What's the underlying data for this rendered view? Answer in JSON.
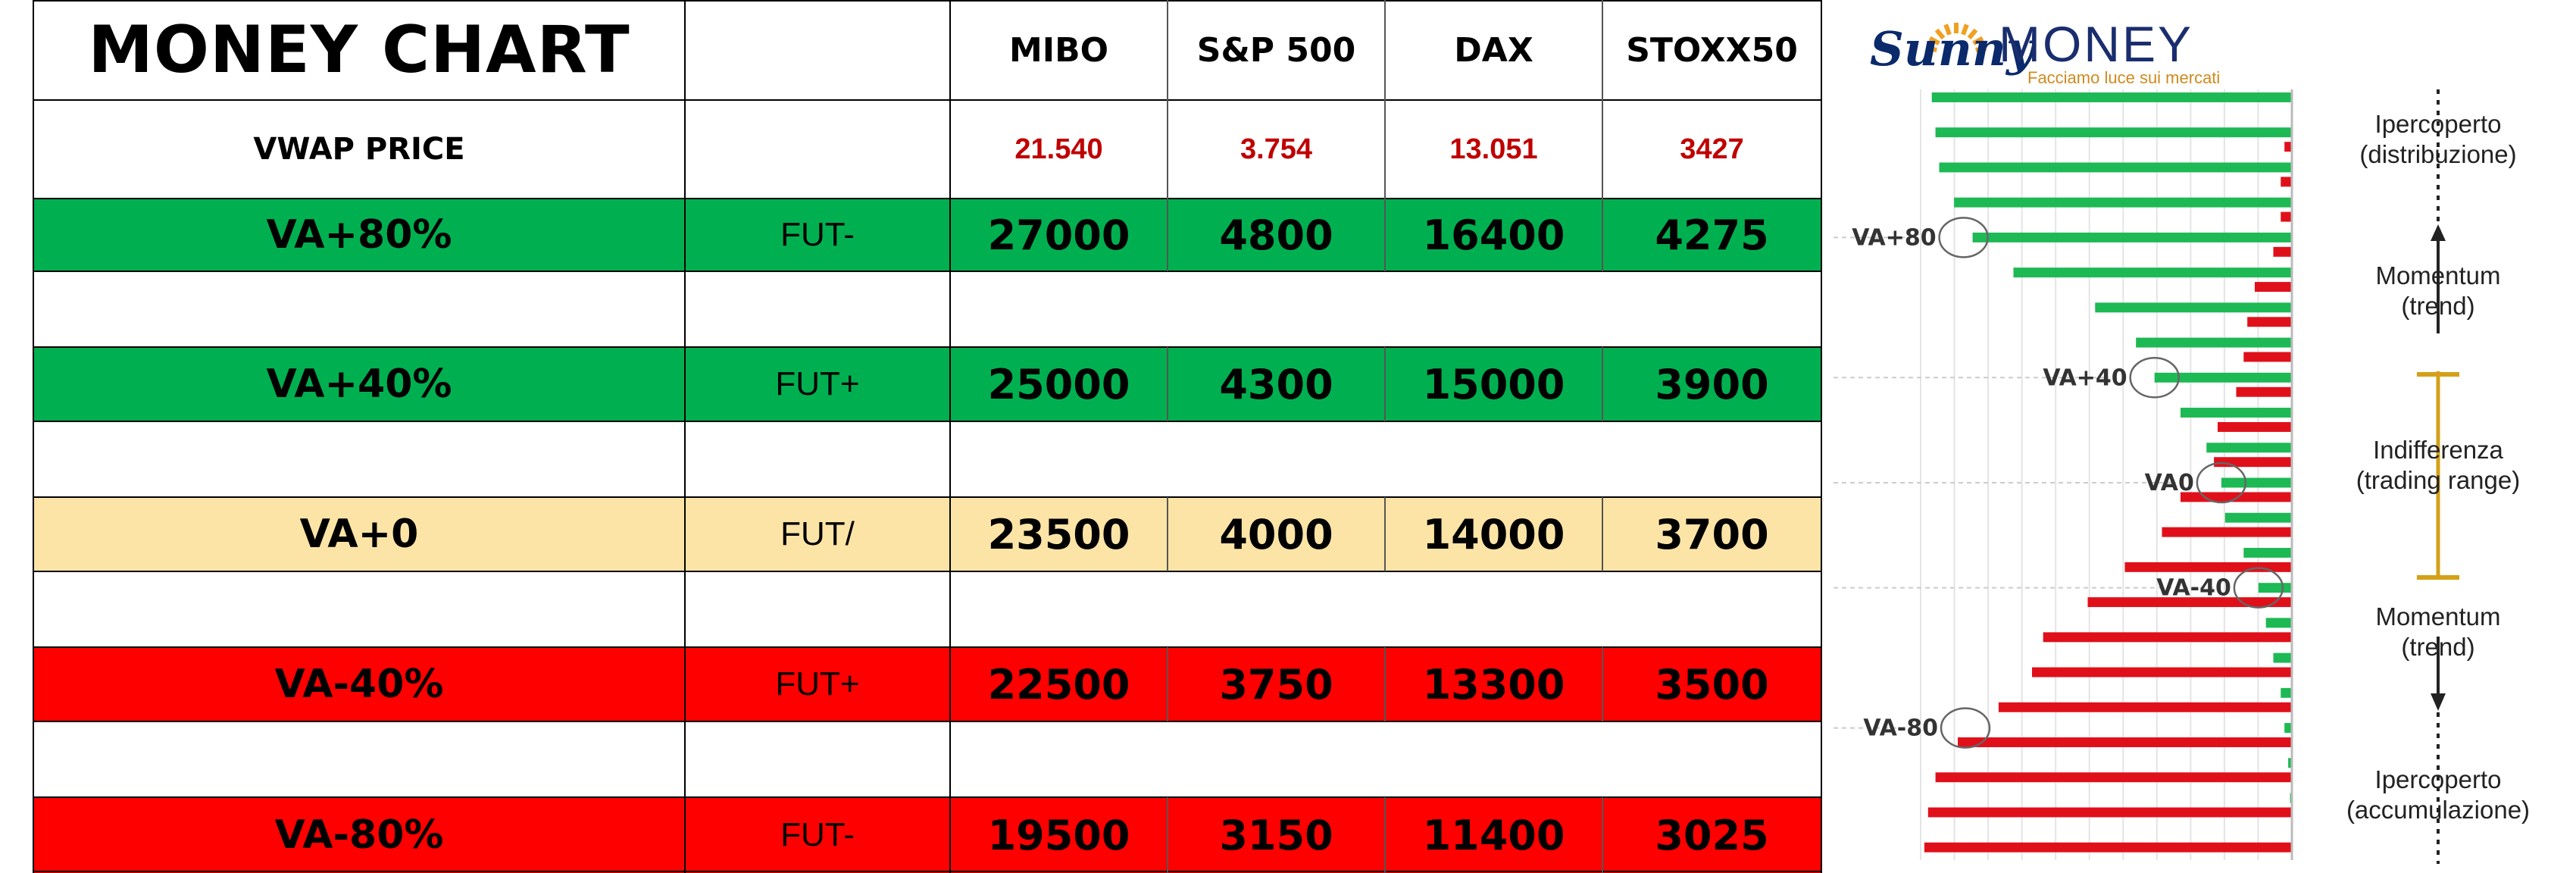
{
  "table": {
    "title": "MONEY CHART",
    "indices": [
      "MIBO",
      "S&P 500",
      "DAX",
      "STOXX50"
    ],
    "vwap": {
      "label": "VWAP PRICE",
      "values": [
        "21.540",
        "3.754",
        "13.051",
        "3427"
      ]
    },
    "levels": [
      {
        "label": "VA+80%",
        "fut": "FUT-",
        "values": [
          "27000",
          "4800",
          "16400",
          "4275"
        ],
        "color": "#00b050"
      },
      {
        "label": "VA+40%",
        "fut": "FUT+",
        "values": [
          "25000",
          "4300",
          "15000",
          "3900"
        ],
        "color": "#00b050"
      },
      {
        "label": "VA+0",
        "fut": "FUT/",
        "values": [
          "23500",
          "4000",
          "14000",
          "3700"
        ],
        "color": "#fce4a6"
      },
      {
        "label": "VA-40%",
        "fut": "FUT+",
        "values": [
          "22500",
          "3750",
          "13300",
          "3500"
        ],
        "color": "#ff0000"
      },
      {
        "label": "VA-80%",
        "fut": "FUT-",
        "values": [
          "19500",
          "3150",
          "11400",
          "3025"
        ],
        "color": "#ff0000"
      }
    ]
  },
  "logo": {
    "brand_script": "Sunny",
    "brand": "MONEY",
    "tagline": "Facciamo luce sui mercati"
  },
  "chart_data": {
    "type": "bar",
    "description_series": [
      "green",
      "red"
    ],
    "rows": [
      {
        "green": 0.97,
        "red": 0.0
      },
      {
        "green": 0.96,
        "red": 0.02
      },
      {
        "green": 0.95,
        "red": 0.03
      },
      {
        "green": 0.91,
        "red": 0.03
      },
      {
        "green": 0.86,
        "red": 0.05
      },
      {
        "green": 0.75,
        "red": 0.1
      },
      {
        "green": 0.53,
        "red": 0.12
      },
      {
        "green": 0.42,
        "red": 0.13
      },
      {
        "green": 0.37,
        "red": 0.15
      },
      {
        "green": 0.3,
        "red": 0.2
      },
      {
        "green": 0.23,
        "red": 0.21
      },
      {
        "green": 0.19,
        "red": 0.3
      },
      {
        "green": 0.18,
        "red": 0.35
      },
      {
        "green": 0.13,
        "red": 0.45
      },
      {
        "green": 0.09,
        "red": 0.55
      },
      {
        "green": 0.07,
        "red": 0.67
      },
      {
        "green": 0.05,
        "red": 0.7
      },
      {
        "green": 0.03,
        "red": 0.79
      },
      {
        "green": 0.02,
        "red": 0.9
      },
      {
        "green": 0.01,
        "red": 0.96
      },
      {
        "green": 0.005,
        "red": 0.98
      },
      {
        "green": 0.0,
        "red": 0.99
      }
    ],
    "level_labels": [
      {
        "label": "VA+80",
        "row": 4
      },
      {
        "label": "VA+40",
        "row": 8
      },
      {
        "label": "VA0",
        "row": 11
      },
      {
        "label": "VA-40",
        "row": 14
      },
      {
        "label": "VA-80",
        "row": 18
      }
    ],
    "zones": [
      {
        "line1": "Ipercoperto",
        "line2": "(distribuzione)"
      },
      {
        "line1": "Momentum",
        "line2": "(trend)"
      },
      {
        "line1": "Indifferenza",
        "line2": "(trading range)"
      },
      {
        "line1": "Momentum",
        "line2": "(trend)"
      },
      {
        "line1": "Ipercoperto",
        "line2": "(accumulazione)"
      }
    ],
    "colors": {
      "green": "#1db954",
      "red": "#e0101a",
      "gold": "#d4a017"
    }
  }
}
